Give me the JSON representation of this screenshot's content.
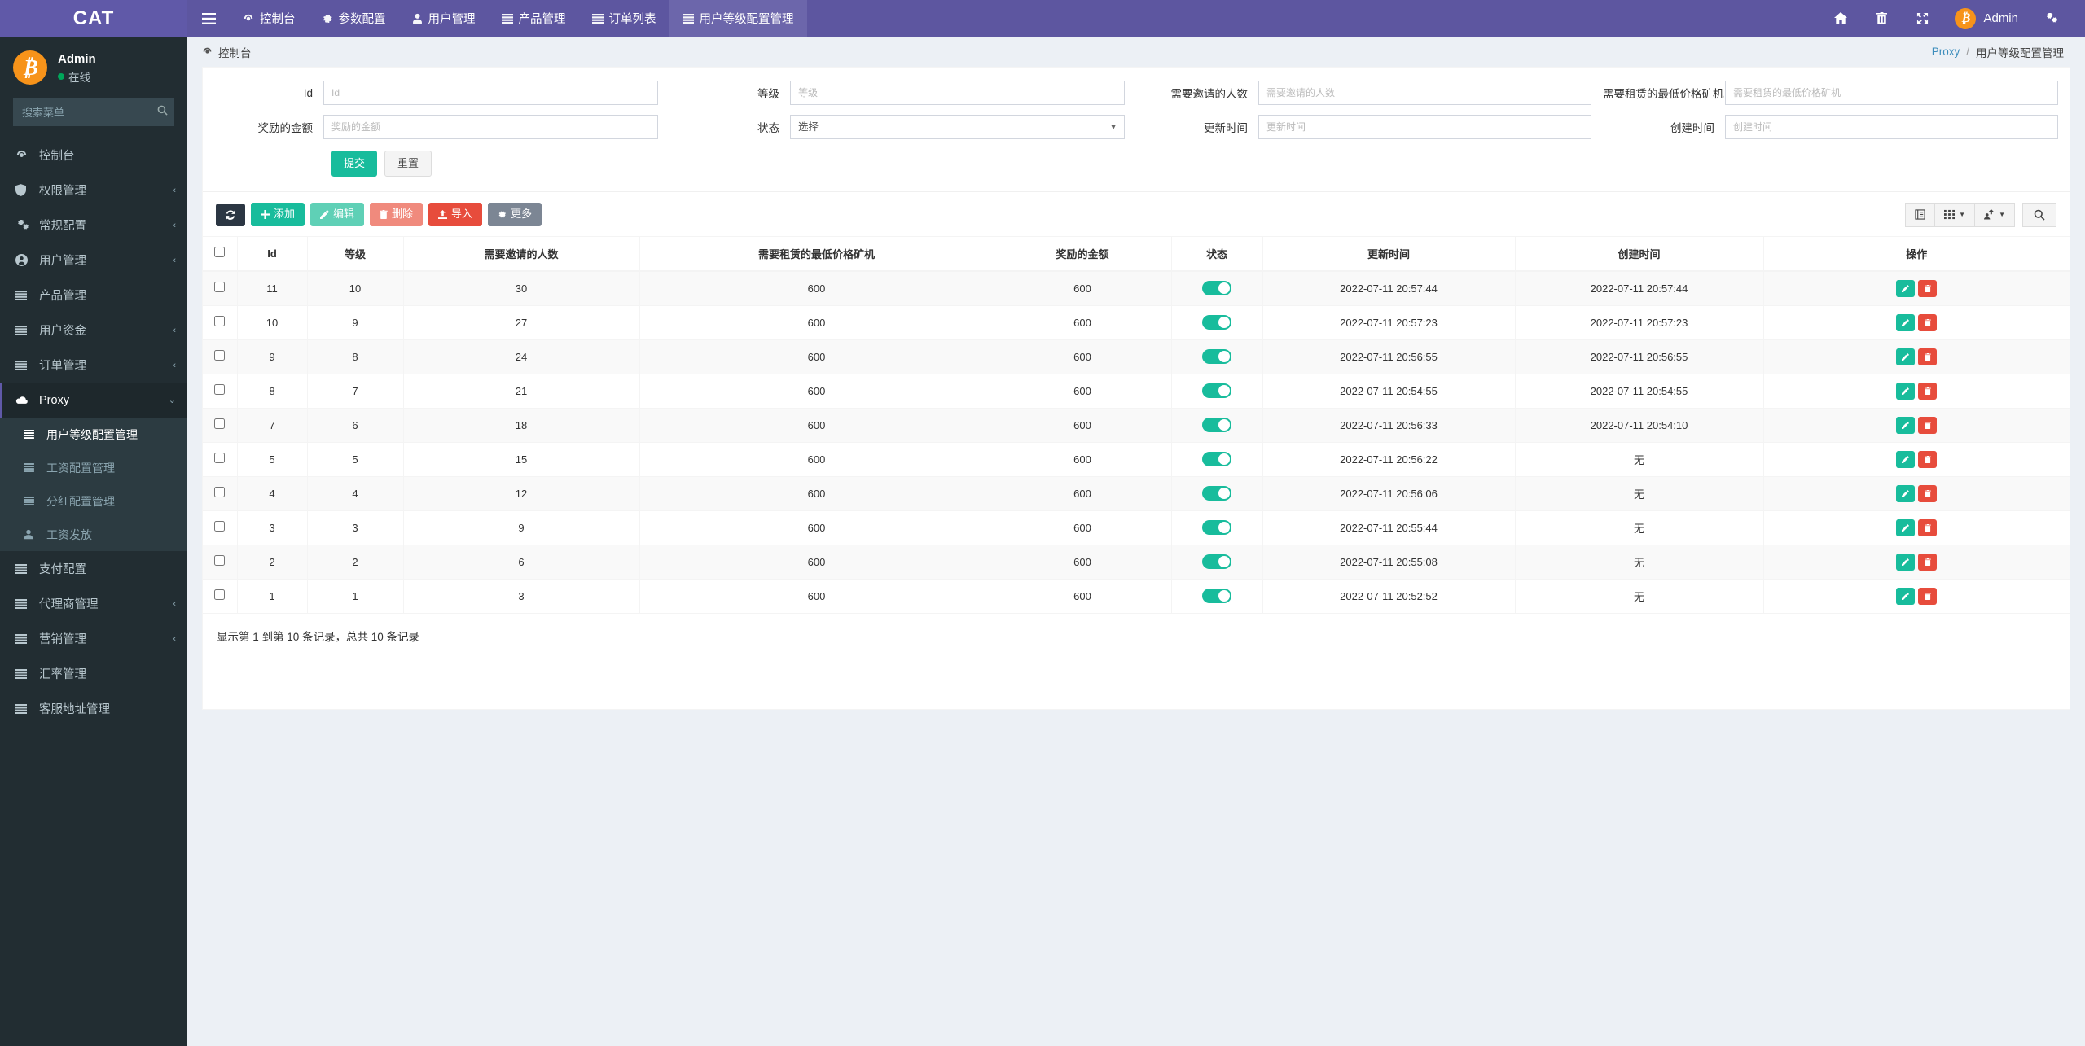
{
  "brand": {
    "logo_text": "CAT"
  },
  "navbar": {
    "toggle_icon": "hamburger-icon",
    "items": [
      {
        "label": "控制台",
        "icon": "dashboard-icon",
        "active": false
      },
      {
        "label": "参数配置",
        "icon": "gear-icon",
        "active": false
      },
      {
        "label": "用户管理",
        "icon": "user-icon",
        "active": false
      },
      {
        "label": "产品管理",
        "icon": "list-icon",
        "active": false
      },
      {
        "label": "订单列表",
        "icon": "list-icon",
        "active": false
      },
      {
        "label": "用户等级配置管理",
        "icon": "list-icon",
        "active": true
      }
    ],
    "right_icons": [
      "home-icon",
      "trash-icon",
      "fullscreen-icon",
      "cogs-icon"
    ],
    "user_name": "Admin",
    "avatar_glyph": "₿"
  },
  "sidebar": {
    "user": {
      "name": "Admin",
      "status": "在线",
      "avatar_glyph": "₿"
    },
    "search_placeholder": "搜索菜单",
    "search_value": "",
    "items": [
      {
        "label": "控制台",
        "icon": "dashboard-icon",
        "arrow": "",
        "active": false
      },
      {
        "label": "权限管理",
        "icon": "shield-icon",
        "arrow": "‹",
        "active": false
      },
      {
        "label": "常规配置",
        "icon": "cogs-icon",
        "arrow": "‹",
        "active": false
      },
      {
        "label": "用户管理",
        "icon": "user-circle-icon",
        "arrow": "‹",
        "active": false
      },
      {
        "label": "产品管理",
        "icon": "list-icon",
        "arrow": "",
        "active": false
      },
      {
        "label": "用户资金",
        "icon": "list-icon",
        "arrow": "‹",
        "active": false
      },
      {
        "label": "订单管理",
        "icon": "list-icon",
        "arrow": "‹",
        "active": false
      },
      {
        "label": "Proxy",
        "icon": "cloud-icon",
        "arrow": "⌄",
        "active": true
      }
    ],
    "submenu": [
      {
        "label": "用户等级配置管理",
        "icon": "list-icon",
        "active": true
      },
      {
        "label": "工资配置管理",
        "icon": "list-icon",
        "active": false
      },
      {
        "label": "分红配置管理",
        "icon": "list-icon",
        "active": false
      },
      {
        "label": "工资发放",
        "icon": "user-icon",
        "active": false
      }
    ],
    "items_after": [
      {
        "label": "支付配置",
        "icon": "list-icon",
        "arrow": "",
        "active": false
      },
      {
        "label": "代理商管理",
        "icon": "list-icon",
        "arrow": "‹",
        "active": false
      },
      {
        "label": "营销管理",
        "icon": "list-icon",
        "arrow": "‹",
        "active": false
      },
      {
        "label": "汇率管理",
        "icon": "list-icon",
        "arrow": "",
        "active": false
      },
      {
        "label": "客服地址管理",
        "icon": "list-icon",
        "arrow": "",
        "active": false
      }
    ]
  },
  "breadcrumb": {
    "icon": "dashboard-icon",
    "title": "控制台",
    "trail_link": "Proxy",
    "separator": "/",
    "current": "用户等级配置管理"
  },
  "search_form": {
    "fields": [
      {
        "label": "Id",
        "placeholder": "Id",
        "value": "",
        "type": "text"
      },
      {
        "label": "等级",
        "placeholder": "等级",
        "value": "",
        "type": "text"
      },
      {
        "label": "需要邀请的人数",
        "placeholder": "需要邀请的人数",
        "value": "",
        "type": "text"
      },
      {
        "label": "需要租赁的最低价格矿机",
        "placeholder": "需要租赁的最低价格矿机",
        "value": "",
        "type": "text"
      },
      {
        "label": "奖励的金额",
        "placeholder": "奖励的金额",
        "value": "",
        "type": "text"
      },
      {
        "label": "状态",
        "placeholder": "选择",
        "value": "选择",
        "type": "select"
      },
      {
        "label": "更新时间",
        "placeholder": "更新时间",
        "value": "",
        "type": "text"
      },
      {
        "label": "创建时间",
        "placeholder": "创建时间",
        "value": "",
        "type": "text"
      }
    ],
    "submit_label": "提交",
    "reset_label": "重置"
  },
  "toolbar": {
    "refresh_icon": "refresh-icon",
    "add_label": "添加",
    "edit_label": "编辑",
    "delete_label": "删除",
    "import_label": "导入",
    "more_label": "更多",
    "right_icons": [
      "columns-icon",
      "grid-icon",
      "export-icon",
      "search-icon"
    ]
  },
  "table": {
    "columns": [
      "Id",
      "等级",
      "需要邀请的人数",
      "需要租赁的最低价格矿机",
      "奖励的金额",
      "状态",
      "更新时间",
      "创建时间",
      "操作"
    ],
    "rows": [
      {
        "id": "11",
        "level": "10",
        "invites": "30",
        "min_price": "600",
        "reward": "600",
        "status": true,
        "updated": "2022-07-11 20:57:44",
        "created": "2022-07-11 20:57:44"
      },
      {
        "id": "10",
        "level": "9",
        "invites": "27",
        "min_price": "600",
        "reward": "600",
        "status": true,
        "updated": "2022-07-11 20:57:23",
        "created": "2022-07-11 20:57:23"
      },
      {
        "id": "9",
        "level": "8",
        "invites": "24",
        "min_price": "600",
        "reward": "600",
        "status": true,
        "updated": "2022-07-11 20:56:55",
        "created": "2022-07-11 20:56:55"
      },
      {
        "id": "8",
        "level": "7",
        "invites": "21",
        "min_price": "600",
        "reward": "600",
        "status": true,
        "updated": "2022-07-11 20:54:55",
        "created": "2022-07-11 20:54:55"
      },
      {
        "id": "7",
        "level": "6",
        "invites": "18",
        "min_price": "600",
        "reward": "600",
        "status": true,
        "updated": "2022-07-11 20:56:33",
        "created": "2022-07-11 20:54:10"
      },
      {
        "id": "5",
        "level": "5",
        "invites": "15",
        "min_price": "600",
        "reward": "600",
        "status": true,
        "updated": "2022-07-11 20:56:22",
        "created": "无"
      },
      {
        "id": "4",
        "level": "4",
        "invites": "12",
        "min_price": "600",
        "reward": "600",
        "status": true,
        "updated": "2022-07-11 20:56:06",
        "created": "无"
      },
      {
        "id": "3",
        "level": "3",
        "invites": "9",
        "min_price": "600",
        "reward": "600",
        "status": true,
        "updated": "2022-07-11 20:55:44",
        "created": "无"
      },
      {
        "id": "2",
        "level": "2",
        "invites": "6",
        "min_price": "600",
        "reward": "600",
        "status": true,
        "updated": "2022-07-11 20:55:08",
        "created": "无"
      },
      {
        "id": "1",
        "level": "1",
        "invites": "3",
        "min_price": "600",
        "reward": "600",
        "status": true,
        "updated": "2022-07-11 20:52:52",
        "created": "无"
      }
    ],
    "footer_text": "显示第 1 到第 10 条记录，总共 10 条记录"
  },
  "colors": {
    "navbar": "#5d56a0",
    "logo_bg": "#6059a8",
    "sidebar": "#222d32",
    "submenu": "#2c3b41",
    "accent_green": "#18bc9c",
    "danger_red": "#e74c3c",
    "bitcoin_orange": "#f7931a",
    "link_blue": "#3c8dbc"
  }
}
